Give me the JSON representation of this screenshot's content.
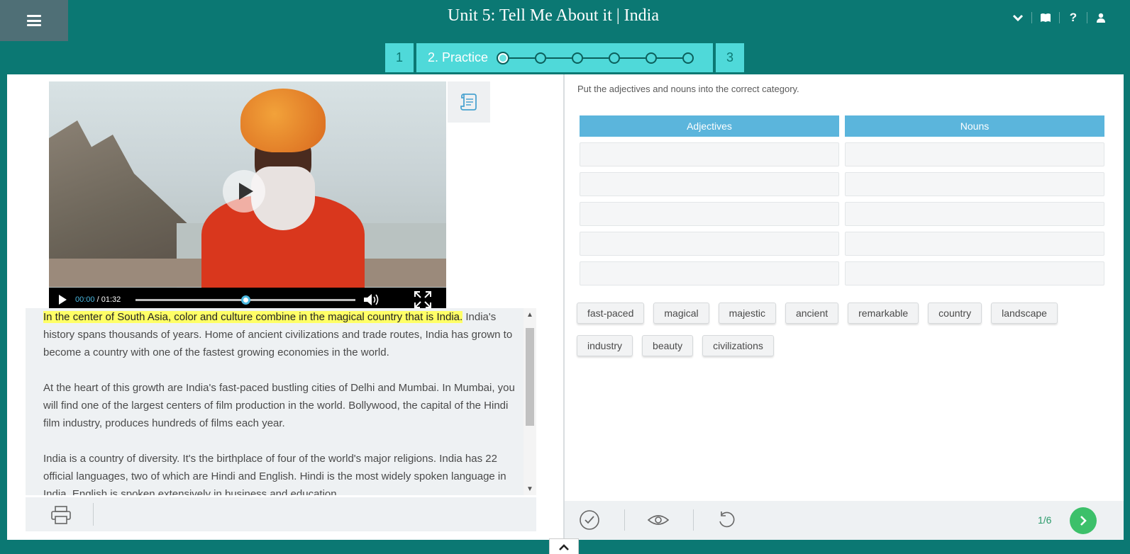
{
  "header": {
    "title": "Unit 5: Tell Me About it | India",
    "icons": [
      "menu-icon",
      "chevron-down-icon",
      "book-icon",
      "help-icon",
      "user-icon"
    ]
  },
  "steps": {
    "step1": "1",
    "step2": "2. Practice",
    "step3": "3",
    "progress_dots": 6,
    "current_dot": 1
  },
  "video": {
    "current_time": "00:00",
    "duration": "/ 01:32",
    "icons": [
      "play-icon",
      "volume-icon",
      "fullscreen-icon",
      "transcript-icon"
    ]
  },
  "reading": {
    "highlight": "In the center of South Asia, color and culture combine in the magical country that is India.",
    "p1_rest": " India's history spans thousands of years. Home of ancient civilizations and trade routes, India has grown to become a country with one of the fastest growing economies in the world.",
    "p2": "At the heart of this growth are India's fast-paced bustling cities of Delhi and Mumbai. In Mumbai, you will find one of the largest centers of film production in the world. Bollywood, the capital of the Hindi film industry, produces hundreds of films each year.",
    "p3": "India is a country of diversity. It's the birthplace of four of the world's major religions. India has 22 official languages, two of which are Hindi and English. Hindi is the most widely spoken language in India. English is spoken extensively in business and education."
  },
  "exercise": {
    "instruction": "Put the adjectives and nouns into the correct category.",
    "columns": [
      "Adjectives",
      "Nouns"
    ],
    "slots_per_column": 5,
    "words": [
      "fast-paced",
      "magical",
      "majestic",
      "ancient",
      "remarkable",
      "country",
      "landscape",
      "industry",
      "beauty",
      "civilizations"
    ]
  },
  "footer": {
    "counter": "1/6",
    "icons": [
      "print-icon",
      "check-icon",
      "eye-icon",
      "reset-icon",
      "next-arrow-icon",
      "chevron-up-icon"
    ]
  },
  "colors": {
    "brand_teal": "#0b7873",
    "step_cyan": "#4fd9d9",
    "column_header_blue": "#5bb5dc",
    "highlight_yellow": "#ffff66",
    "next_green": "#3cc06a"
  }
}
